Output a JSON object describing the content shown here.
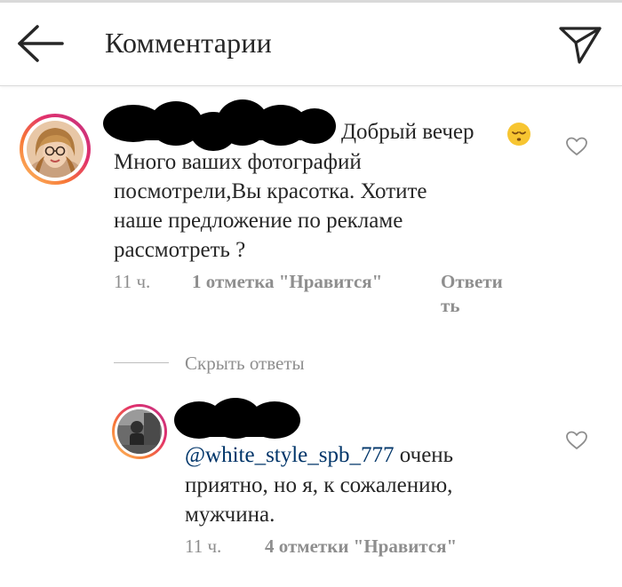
{
  "header": {
    "title": "Комментарии",
    "back_icon": "arrow-left-icon",
    "direct_icon": "paper-plane-icon"
  },
  "comment": {
    "username_visible": "_ _",
    "greeting": "Добрый вечер",
    "emoji": "sleepy-face-emoji",
    "lines": [
      "Много ваших фотографий",
      "посмотрели,Вы красотка. Хотите",
      "наше предложение по рекламе",
      "рассмотреть ?"
    ],
    "time": "11 ч.",
    "likes": "1 отметка \"Нравится\"",
    "reply_line1": "Ответи",
    "reply_line2": "ть"
  },
  "replies_toggle": {
    "label": "Скрыть ответы"
  },
  "reply": {
    "mention": "@white_style_spb_777",
    "first_line_rest": "очень",
    "lines": [
      "приятно, но я, к сожалению,",
      "мужчина."
    ],
    "time": "11 ч.",
    "likes": "4 отметки \"Нравится\""
  },
  "colors": {
    "text": "#262626",
    "meta": "#8e8e8e",
    "mention": "#003569",
    "divider": "#dbdbdb"
  }
}
